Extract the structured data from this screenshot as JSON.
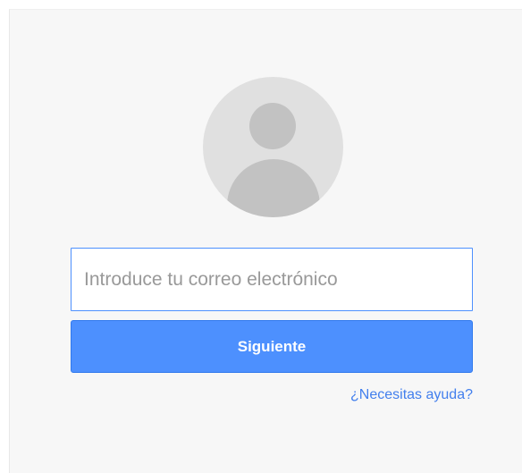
{
  "login": {
    "avatar_icon": "default-user-avatar-icon",
    "email_placeholder": "Introduce tu correo electrónico",
    "email_value": "",
    "next_label": "Siguiente",
    "help_link": "¿Necesitas ayuda?"
  },
  "colors": {
    "accent": "#4d90fe",
    "link": "#427fed",
    "card_background": "#f7f7f7",
    "avatar_background": "#e0e0e0"
  }
}
